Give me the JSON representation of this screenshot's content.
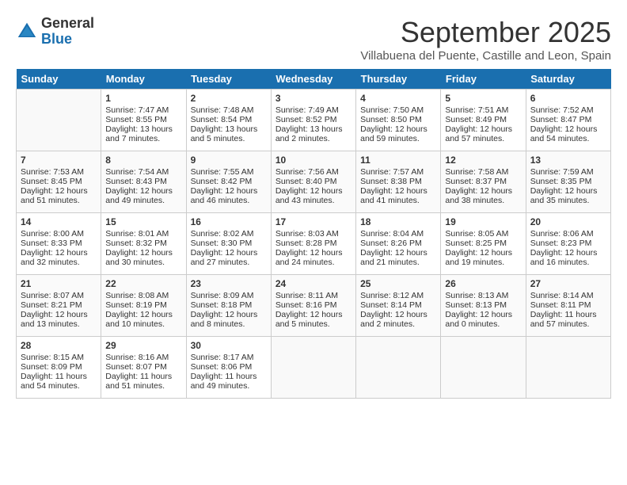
{
  "header": {
    "logo_general": "General",
    "logo_blue": "Blue",
    "month_title": "September 2025",
    "subtitle": "Villabuena del Puente, Castille and Leon, Spain"
  },
  "days_of_week": [
    "Sunday",
    "Monday",
    "Tuesday",
    "Wednesday",
    "Thursday",
    "Friday",
    "Saturday"
  ],
  "weeks": [
    [
      {
        "day": "",
        "sunrise": "",
        "sunset": "",
        "daylight": ""
      },
      {
        "day": "1",
        "sunrise": "Sunrise: 7:47 AM",
        "sunset": "Sunset: 8:55 PM",
        "daylight": "Daylight: 13 hours and 7 minutes."
      },
      {
        "day": "2",
        "sunrise": "Sunrise: 7:48 AM",
        "sunset": "Sunset: 8:54 PM",
        "daylight": "Daylight: 13 hours and 5 minutes."
      },
      {
        "day": "3",
        "sunrise": "Sunrise: 7:49 AM",
        "sunset": "Sunset: 8:52 PM",
        "daylight": "Daylight: 13 hours and 2 minutes."
      },
      {
        "day": "4",
        "sunrise": "Sunrise: 7:50 AM",
        "sunset": "Sunset: 8:50 PM",
        "daylight": "Daylight: 12 hours and 59 minutes."
      },
      {
        "day": "5",
        "sunrise": "Sunrise: 7:51 AM",
        "sunset": "Sunset: 8:49 PM",
        "daylight": "Daylight: 12 hours and 57 minutes."
      },
      {
        "day": "6",
        "sunrise": "Sunrise: 7:52 AM",
        "sunset": "Sunset: 8:47 PM",
        "daylight": "Daylight: 12 hours and 54 minutes."
      }
    ],
    [
      {
        "day": "7",
        "sunrise": "Sunrise: 7:53 AM",
        "sunset": "Sunset: 8:45 PM",
        "daylight": "Daylight: 12 hours and 51 minutes."
      },
      {
        "day": "8",
        "sunrise": "Sunrise: 7:54 AM",
        "sunset": "Sunset: 8:43 PM",
        "daylight": "Daylight: 12 hours and 49 minutes."
      },
      {
        "day": "9",
        "sunrise": "Sunrise: 7:55 AM",
        "sunset": "Sunset: 8:42 PM",
        "daylight": "Daylight: 12 hours and 46 minutes."
      },
      {
        "day": "10",
        "sunrise": "Sunrise: 7:56 AM",
        "sunset": "Sunset: 8:40 PM",
        "daylight": "Daylight: 12 hours and 43 minutes."
      },
      {
        "day": "11",
        "sunrise": "Sunrise: 7:57 AM",
        "sunset": "Sunset: 8:38 PM",
        "daylight": "Daylight: 12 hours and 41 minutes."
      },
      {
        "day": "12",
        "sunrise": "Sunrise: 7:58 AM",
        "sunset": "Sunset: 8:37 PM",
        "daylight": "Daylight: 12 hours and 38 minutes."
      },
      {
        "day": "13",
        "sunrise": "Sunrise: 7:59 AM",
        "sunset": "Sunset: 8:35 PM",
        "daylight": "Daylight: 12 hours and 35 minutes."
      }
    ],
    [
      {
        "day": "14",
        "sunrise": "Sunrise: 8:00 AM",
        "sunset": "Sunset: 8:33 PM",
        "daylight": "Daylight: 12 hours and 32 minutes."
      },
      {
        "day": "15",
        "sunrise": "Sunrise: 8:01 AM",
        "sunset": "Sunset: 8:32 PM",
        "daylight": "Daylight: 12 hours and 30 minutes."
      },
      {
        "day": "16",
        "sunrise": "Sunrise: 8:02 AM",
        "sunset": "Sunset: 8:30 PM",
        "daylight": "Daylight: 12 hours and 27 minutes."
      },
      {
        "day": "17",
        "sunrise": "Sunrise: 8:03 AM",
        "sunset": "Sunset: 8:28 PM",
        "daylight": "Daylight: 12 hours and 24 minutes."
      },
      {
        "day": "18",
        "sunrise": "Sunrise: 8:04 AM",
        "sunset": "Sunset: 8:26 PM",
        "daylight": "Daylight: 12 hours and 21 minutes."
      },
      {
        "day": "19",
        "sunrise": "Sunrise: 8:05 AM",
        "sunset": "Sunset: 8:25 PM",
        "daylight": "Daylight: 12 hours and 19 minutes."
      },
      {
        "day": "20",
        "sunrise": "Sunrise: 8:06 AM",
        "sunset": "Sunset: 8:23 PM",
        "daylight": "Daylight: 12 hours and 16 minutes."
      }
    ],
    [
      {
        "day": "21",
        "sunrise": "Sunrise: 8:07 AM",
        "sunset": "Sunset: 8:21 PM",
        "daylight": "Daylight: 12 hours and 13 minutes."
      },
      {
        "day": "22",
        "sunrise": "Sunrise: 8:08 AM",
        "sunset": "Sunset: 8:19 PM",
        "daylight": "Daylight: 12 hours and 10 minutes."
      },
      {
        "day": "23",
        "sunrise": "Sunrise: 8:09 AM",
        "sunset": "Sunset: 8:18 PM",
        "daylight": "Daylight: 12 hours and 8 minutes."
      },
      {
        "day": "24",
        "sunrise": "Sunrise: 8:11 AM",
        "sunset": "Sunset: 8:16 PM",
        "daylight": "Daylight: 12 hours and 5 minutes."
      },
      {
        "day": "25",
        "sunrise": "Sunrise: 8:12 AM",
        "sunset": "Sunset: 8:14 PM",
        "daylight": "Daylight: 12 hours and 2 minutes."
      },
      {
        "day": "26",
        "sunrise": "Sunrise: 8:13 AM",
        "sunset": "Sunset: 8:13 PM",
        "daylight": "Daylight: 12 hours and 0 minutes."
      },
      {
        "day": "27",
        "sunrise": "Sunrise: 8:14 AM",
        "sunset": "Sunset: 8:11 PM",
        "daylight": "Daylight: 11 hours and 57 minutes."
      }
    ],
    [
      {
        "day": "28",
        "sunrise": "Sunrise: 8:15 AM",
        "sunset": "Sunset: 8:09 PM",
        "daylight": "Daylight: 11 hours and 54 minutes."
      },
      {
        "day": "29",
        "sunrise": "Sunrise: 8:16 AM",
        "sunset": "Sunset: 8:07 PM",
        "daylight": "Daylight: 11 hours and 51 minutes."
      },
      {
        "day": "30",
        "sunrise": "Sunrise: 8:17 AM",
        "sunset": "Sunset: 8:06 PM",
        "daylight": "Daylight: 11 hours and 49 minutes."
      },
      {
        "day": "",
        "sunrise": "",
        "sunset": "",
        "daylight": ""
      },
      {
        "day": "",
        "sunrise": "",
        "sunset": "",
        "daylight": ""
      },
      {
        "day": "",
        "sunrise": "",
        "sunset": "",
        "daylight": ""
      },
      {
        "day": "",
        "sunrise": "",
        "sunset": "",
        "daylight": ""
      }
    ]
  ]
}
